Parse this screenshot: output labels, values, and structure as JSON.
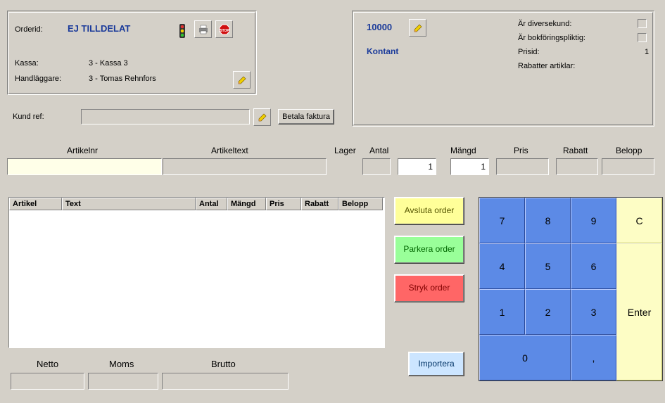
{
  "orderPanel": {
    "orderIdLabel": "Orderid:",
    "orderIdValue": "EJ TILLDELAT",
    "kassaLabel": "Kassa:",
    "kassaValue": "3 - Kassa 3",
    "handlLabel": "Handläggare:",
    "handlValue": "3 - Tomas Rehnfors"
  },
  "kundRef": {
    "label": "Kund ref:",
    "value": "",
    "betalaFaktura": "Betala faktura"
  },
  "customerPanel": {
    "code": "10000",
    "name": "Kontant",
    "diversekundLabel": "Är diversekund:",
    "bokforingsLabel": "Är bokföringspliktig:",
    "prisidLabel": "Prisid:",
    "prisidValue": "1",
    "rabattLabel": "Rabatter artiklar:"
  },
  "columns": {
    "artikelnr": "Artikelnr",
    "artikeltext": "Artikeltext",
    "lager": "Lager",
    "antal": "Antal",
    "mangd": "Mängd",
    "pris": "Pris",
    "rabatt": "Rabatt",
    "belopp": "Belopp"
  },
  "inputs": {
    "artikelnr": "",
    "artikeltext": "",
    "lager": "",
    "antal": "1",
    "mangd": "1",
    "pris": "",
    "rabatt": "",
    "belopp": ""
  },
  "grid": {
    "headers": [
      "Artikel",
      "Text",
      "Antal",
      "Mängd",
      "Pris",
      "Rabatt",
      "Belopp"
    ]
  },
  "totals": {
    "netto": "Netto",
    "moms": "Moms",
    "brutto": "Brutto"
  },
  "actions": {
    "avsluta": "Avsluta order",
    "parkera": "Parkera order",
    "stryk": "Stryk order",
    "importera": "Importera"
  },
  "keypad": {
    "7": "7",
    "8": "8",
    "9": "9",
    "c": "C",
    "4": "4",
    "5": "5",
    "6": "6",
    "1": "1",
    "2": "2",
    "3": "3",
    "0": "0",
    "comma": ",",
    "enter": "Enter"
  }
}
